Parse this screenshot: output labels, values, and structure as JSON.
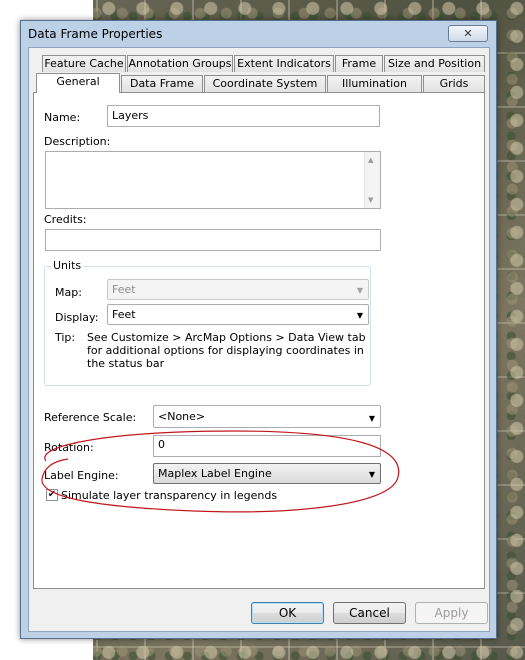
{
  "window": {
    "title": "Data Frame Properties",
    "close_glyph": "✕"
  },
  "tabs_row1": [
    {
      "label": "Feature Cache"
    },
    {
      "label": "Annotation Groups"
    },
    {
      "label": "Extent Indicators"
    },
    {
      "label": "Frame"
    },
    {
      "label": "Size and Position"
    }
  ],
  "tabs_row2": [
    {
      "label": "General",
      "active": true
    },
    {
      "label": "Data Frame"
    },
    {
      "label": "Coordinate System"
    },
    {
      "label": "Illumination"
    },
    {
      "label": "Grids"
    }
  ],
  "general": {
    "name_label": "Name:",
    "name_value": "Layers",
    "description_label": "Description:",
    "description_value": "",
    "credits_label": "Credits:",
    "credits_value": "",
    "units": {
      "group_label": "Units",
      "map_label": "Map:",
      "map_value": "Feet",
      "display_label": "Display:",
      "display_value": "Feet",
      "tip_label": "Tip:",
      "tip_text": "See Customize > ArcMap Options > Data View tab for additional options for displaying coordinates in the status bar"
    },
    "reference_scale_label": "Reference Scale:",
    "reference_scale_value": "<None>",
    "rotation_label": "Rotation:",
    "rotation_value": "0",
    "label_engine_label": "Label Engine:",
    "label_engine_value": "Maplex Label Engine",
    "simulate_transparency_label": "Simulate layer transparency in legends",
    "simulate_transparency_checked": true
  },
  "buttons": {
    "ok": "OK",
    "cancel": "Cancel",
    "apply": "Apply"
  },
  "colors": {
    "window_frame": "#bcd0e6",
    "annotation_ellipse": "#c0171b"
  }
}
